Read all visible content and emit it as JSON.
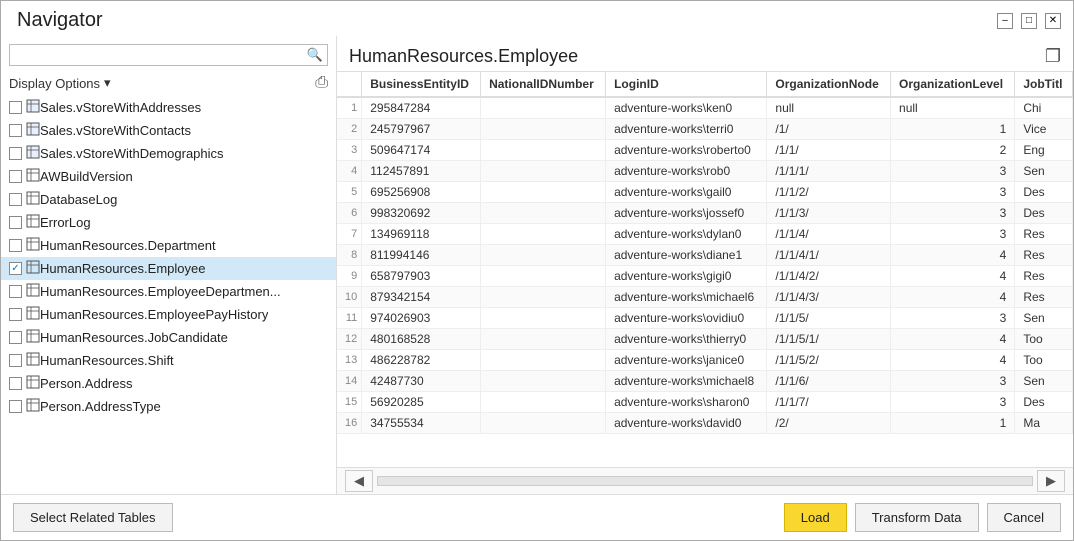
{
  "window": {
    "title": "Navigator",
    "controls": {
      "minimize": "–",
      "restore": "□",
      "close": "✕"
    }
  },
  "leftPanel": {
    "search": {
      "placeholder": "",
      "value": ""
    },
    "displayOptions": {
      "label": "Display Options",
      "arrow": "▾"
    },
    "refreshIcon": "⟳",
    "items": [
      {
        "id": 1,
        "label": "Sales.vStoreWithAddresses",
        "type": "view",
        "checked": false,
        "selected": false
      },
      {
        "id": 2,
        "label": "Sales.vStoreWithContacts",
        "type": "view",
        "checked": false,
        "selected": false
      },
      {
        "id": 3,
        "label": "Sales.vStoreWithDemographics",
        "type": "view",
        "checked": false,
        "selected": false
      },
      {
        "id": 4,
        "label": "AWBuildVersion",
        "type": "table",
        "checked": false,
        "selected": false
      },
      {
        "id": 5,
        "label": "DatabaseLog",
        "type": "table",
        "checked": false,
        "selected": false
      },
      {
        "id": 6,
        "label": "ErrorLog",
        "type": "table",
        "checked": false,
        "selected": false
      },
      {
        "id": 7,
        "label": "HumanResources.Department",
        "type": "table",
        "checked": false,
        "selected": false
      },
      {
        "id": 8,
        "label": "HumanResources.Employee",
        "type": "table",
        "checked": true,
        "selected": true
      },
      {
        "id": 9,
        "label": "HumanResources.EmployeeDepartmen...",
        "type": "table",
        "checked": false,
        "selected": false
      },
      {
        "id": 10,
        "label": "HumanResources.EmployeePayHistory",
        "type": "table",
        "checked": false,
        "selected": false
      },
      {
        "id": 11,
        "label": "HumanResources.JobCandidate",
        "type": "table",
        "checked": false,
        "selected": false
      },
      {
        "id": 12,
        "label": "HumanResources.Shift",
        "type": "table",
        "checked": false,
        "selected": false
      },
      {
        "id": 13,
        "label": "Person.Address",
        "type": "table",
        "checked": false,
        "selected": false
      },
      {
        "id": 14,
        "label": "Person.AddressType",
        "type": "table",
        "checked": false,
        "selected": false
      }
    ]
  },
  "rightPanel": {
    "title": "HumanResources.Employee",
    "columns": [
      "BusinessEntityID",
      "NationalIDNumber",
      "LoginID",
      "OrganizationNode",
      "OrganizationLevel",
      "JobTitl"
    ],
    "rows": [
      {
        "row": 1,
        "BusinessEntityID": "295847284",
        "NationalIDNumber": "",
        "LoginID": "adventure-works\\ken0",
        "OrganizationNode": "null",
        "OrganizationLevel": "null",
        "JobTitl": "Chi"
      },
      {
        "row": 2,
        "BusinessEntityID": "245797967",
        "NationalIDNumber": "",
        "LoginID": "adventure-works\\terri0",
        "OrganizationNode": "/1/",
        "OrganizationLevel": "1",
        "JobTitl": "Vice"
      },
      {
        "row": 3,
        "BusinessEntityID": "509647174",
        "NationalIDNumber": "",
        "LoginID": "adventure-works\\roberto0",
        "OrganizationNode": "/1/1/",
        "OrganizationLevel": "2",
        "JobTitl": "Eng"
      },
      {
        "row": 4,
        "BusinessEntityID": "112457891",
        "NationalIDNumber": "",
        "LoginID": "adventure-works\\rob0",
        "OrganizationNode": "/1/1/1/",
        "OrganizationLevel": "3",
        "JobTitl": "Sen"
      },
      {
        "row": 5,
        "BusinessEntityID": "695256908",
        "NationalIDNumber": "",
        "LoginID": "adventure-works\\gail0",
        "OrganizationNode": "/1/1/2/",
        "OrganizationLevel": "3",
        "JobTitl": "Des"
      },
      {
        "row": 6,
        "BusinessEntityID": "998320692",
        "NationalIDNumber": "",
        "LoginID": "adventure-works\\jossef0",
        "OrganizationNode": "/1/1/3/",
        "OrganizationLevel": "3",
        "JobTitl": "Des"
      },
      {
        "row": 7,
        "BusinessEntityID": "134969118",
        "NationalIDNumber": "",
        "LoginID": "adventure-works\\dylan0",
        "OrganizationNode": "/1/1/4/",
        "OrganizationLevel": "3",
        "JobTitl": "Res"
      },
      {
        "row": 8,
        "BusinessEntityID": "811994146",
        "NationalIDNumber": "",
        "LoginID": "adventure-works\\diane1",
        "OrganizationNode": "/1/1/4/1/",
        "OrganizationLevel": "4",
        "JobTitl": "Res"
      },
      {
        "row": 9,
        "BusinessEntityID": "658797903",
        "NationalIDNumber": "",
        "LoginID": "adventure-works\\gigi0",
        "OrganizationNode": "/1/1/4/2/",
        "OrganizationLevel": "4",
        "JobTitl": "Res"
      },
      {
        "row": 10,
        "BusinessEntityID": "879342154",
        "NationalIDNumber": "",
        "LoginID": "adventure-works\\michael6",
        "OrganizationNode": "/1/1/4/3/",
        "OrganizationLevel": "4",
        "JobTitl": "Res"
      },
      {
        "row": 11,
        "BusinessEntityID": "974026903",
        "NationalIDNumber": "",
        "LoginID": "adventure-works\\ovidiu0",
        "OrganizationNode": "/1/1/5/",
        "OrganizationLevel": "3",
        "JobTitl": "Sen"
      },
      {
        "row": 12,
        "BusinessEntityID": "480168528",
        "NationalIDNumber": "",
        "LoginID": "adventure-works\\thierry0",
        "OrganizationNode": "/1/1/5/1/",
        "OrganizationLevel": "4",
        "JobTitl": "Too"
      },
      {
        "row": 13,
        "BusinessEntityID": "486228782",
        "NationalIDNumber": "",
        "LoginID": "adventure-works\\janice0",
        "OrganizationNode": "/1/1/5/2/",
        "OrganizationLevel": "4",
        "JobTitl": "Too"
      },
      {
        "row": 14,
        "BusinessEntityID": "42487730",
        "NationalIDNumber": "",
        "LoginID": "adventure-works\\michael8",
        "OrganizationNode": "/1/1/6/",
        "OrganizationLevel": "3",
        "JobTitl": "Sen"
      },
      {
        "row": 15,
        "BusinessEntityID": "56920285",
        "NationalIDNumber": "",
        "LoginID": "adventure-works\\sharon0",
        "OrganizationNode": "/1/1/7/",
        "OrganizationLevel": "3",
        "JobTitl": "Des"
      },
      {
        "row": 16,
        "BusinessEntityID": "34755534",
        "NationalIDNumber": "",
        "LoginID": "adventure-works\\david0",
        "OrganizationNode": "/2/",
        "OrganizationLevel": "1",
        "JobTitl": "Ma"
      }
    ]
  },
  "footer": {
    "selectRelatedTables": "Select Related Tables",
    "load": "Load",
    "transformData": "Transform Data",
    "cancel": "Cancel"
  }
}
